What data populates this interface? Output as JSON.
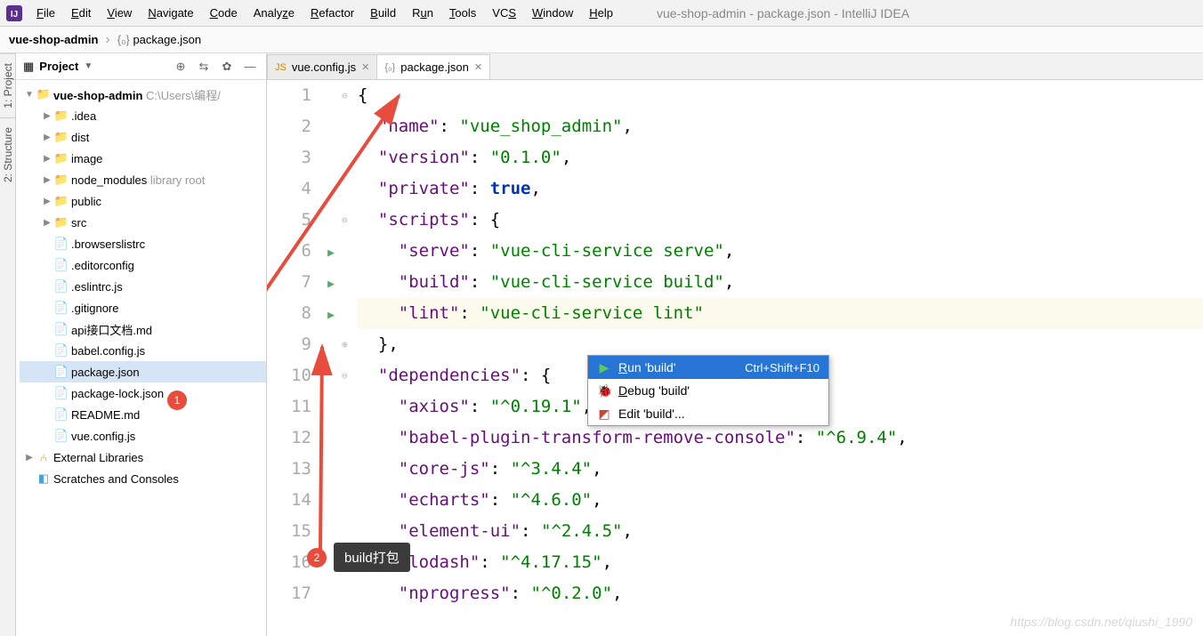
{
  "menu": {
    "items": [
      "File",
      "Edit",
      "View",
      "Navigate",
      "Code",
      "Analyze",
      "Refactor",
      "Build",
      "Run",
      "Tools",
      "VCS",
      "Window",
      "Help"
    ]
  },
  "window_title": "vue-shop-admin - package.json - IntelliJ IDEA",
  "breadcrumb": {
    "project": "vue-shop-admin",
    "file": "package.json"
  },
  "left_tabs": [
    "1: Project",
    "2: Structure"
  ],
  "sidebar": {
    "title": "Project",
    "root": {
      "name": "vue-shop-admin",
      "path": "C:\\Users\\编程/"
    },
    "nodes": [
      {
        "name": ".idea",
        "type": "folder",
        "exp": true
      },
      {
        "name": "dist",
        "type": "folder",
        "exp": true,
        "color": "orange"
      },
      {
        "name": "image",
        "type": "folder",
        "exp": true
      },
      {
        "name": "node_modules",
        "type": "folder",
        "exp": true,
        "suffix": "library root"
      },
      {
        "name": "public",
        "type": "folder",
        "exp": false
      },
      {
        "name": "src",
        "type": "folder",
        "exp": true
      },
      {
        "name": ".browserslistrc",
        "type": "file"
      },
      {
        "name": ".editorconfig",
        "type": "file"
      },
      {
        "name": ".eslintrc.js",
        "type": "file"
      },
      {
        "name": ".gitignore",
        "type": "file"
      },
      {
        "name": "api接口文档.md",
        "type": "file"
      },
      {
        "name": "babel.config.js",
        "type": "file"
      },
      {
        "name": "package.json",
        "type": "file",
        "selected": true
      },
      {
        "name": "package-lock.json",
        "type": "file"
      },
      {
        "name": "README.md",
        "type": "file"
      },
      {
        "name": "vue.config.js",
        "type": "file"
      }
    ],
    "extra": [
      "External Libraries",
      "Scratches and Consoles"
    ]
  },
  "tabs": [
    {
      "label": "vue.config.js",
      "active": false
    },
    {
      "label": "package.json",
      "active": true
    }
  ],
  "code_lines": [
    "{",
    "  \"name\": \"vue_shop_admin\",",
    "  \"version\": \"0.1.0\",",
    "  \"private\": true,",
    "  \"scripts\": {",
    "    \"serve\": \"vue-cli-service serve\",",
    "    \"build\": \"vue-cli-service build\",",
    "    \"lint\": \"vue-cli-service lint\"",
    "  },",
    "  \"dependencies\": {",
    "    \"axios\": \"^0.19.1\",",
    "    \"babel-plugin-transform-remove-console\": \"^6.9.4\",",
    "    \"core-js\": \"^3.4.4\",",
    "    \"echarts\": \"^4.6.0\",",
    "    \"element-ui\": \"^2.4.5\",",
    "    \"lodash\": \"^4.17.15\",",
    "    \"nprogress\": \"^0.2.0\","
  ],
  "run_gutter_lines": [
    6,
    7,
    8
  ],
  "context_menu": {
    "items": [
      {
        "label": "Run 'build'",
        "shortcut": "Ctrl+Shift+F10",
        "icon": "play",
        "selected": true
      },
      {
        "label": "Debug 'build'",
        "icon": "bug"
      },
      {
        "label": "Edit 'build'...",
        "icon": "edit"
      }
    ]
  },
  "annotations": {
    "callout1": "1",
    "callout2": "2",
    "tooltip": "build打包"
  },
  "watermark": "https://blog.csdn.net/qiushi_1990"
}
